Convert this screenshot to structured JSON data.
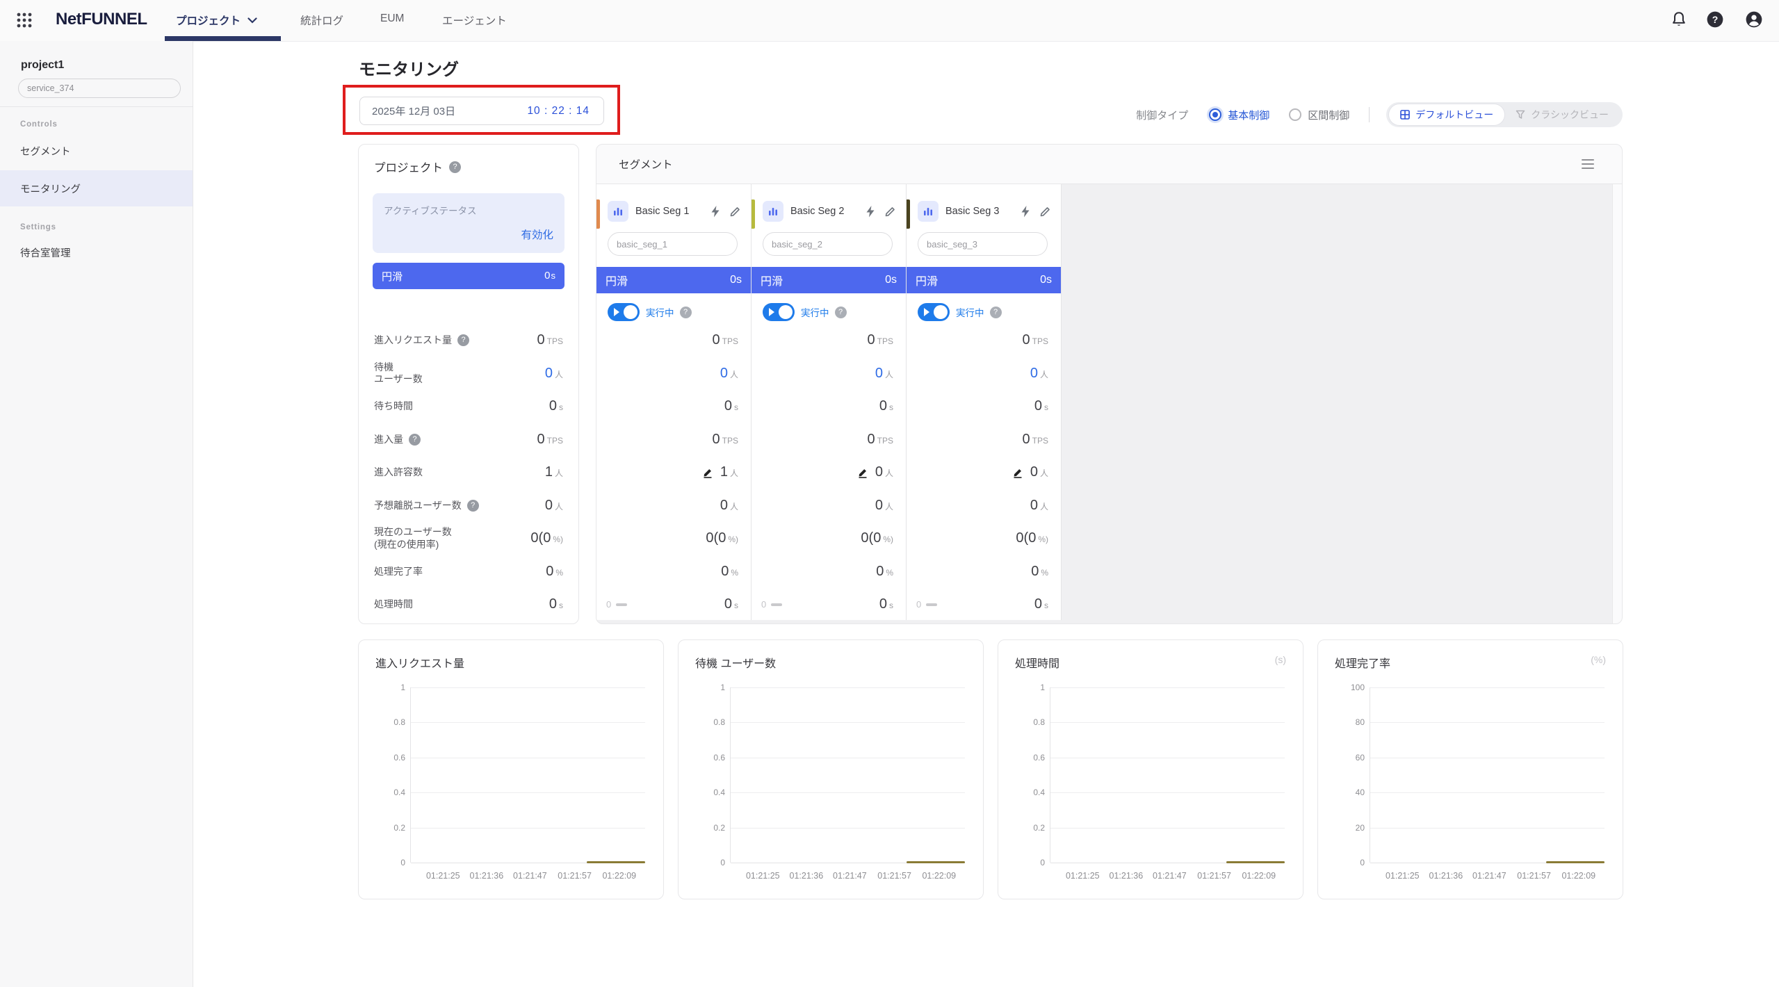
{
  "nav": {
    "logo": "NetFUNNEL",
    "tabs": [
      {
        "label": "プロジェクト",
        "active": true,
        "has_dropdown": true
      },
      {
        "label": "統計ログ",
        "active": false
      },
      {
        "label": "EUM",
        "active": false
      },
      {
        "label": "エージェント",
        "active": false
      }
    ],
    "right_icons": [
      "bell-icon",
      "help-icon",
      "account-icon"
    ],
    "left_icon": "apps-grid-icon"
  },
  "sidebar": {
    "project_name": "project1",
    "service_input": "service_374",
    "sections": [
      {
        "title": "Controls",
        "items": [
          {
            "label": "セグメント",
            "active": false
          },
          {
            "label": "モニタリング",
            "active": true
          }
        ]
      },
      {
        "title": "Settings",
        "items": [
          {
            "label": "待合室管理",
            "active": false
          }
        ]
      }
    ]
  },
  "page": {
    "title": "モニタリング",
    "date": "2025年 12月 03日",
    "time": "10 : 22 : 14",
    "control_type": {
      "label": "制御タイプ",
      "options": [
        {
          "label": "基本制御",
          "selected": true
        },
        {
          "label": "区間制御",
          "selected": false
        }
      ]
    },
    "view_toggle": [
      {
        "label": "デフォルトビュー",
        "active": true,
        "icon": "grid-view-icon"
      },
      {
        "label": "クラシックビュー",
        "active": false,
        "icon": "funnel-icon"
      }
    ]
  },
  "colors": {
    "accent_blue": "#2e6be5",
    "banner_blue": "#4d68ee",
    "toggle_blue": "#1e7bea",
    "nav_navy": "#2c3766",
    "annotation_red": "#df1d1d",
    "chart_line_olive": "#8a7b35"
  },
  "project_card": {
    "title": "プロジェクト",
    "status_label": "アクティブステータス",
    "status_value": "有効化",
    "banner": {
      "label": "円滑",
      "value": "0",
      "unit": "s"
    },
    "metrics": [
      {
        "label": "進入リクエスト量",
        "help": true,
        "value": "0",
        "unit": "TPS"
      },
      {
        "label": "待機\nユーザー数",
        "value": "0",
        "unit": "人",
        "blue": true
      },
      {
        "label": "待ち時間",
        "value": "0",
        "unit": "s"
      },
      {
        "label": "進入量",
        "help": true,
        "value": "0",
        "unit": "TPS"
      },
      {
        "label": "進入許容数",
        "value": "1",
        "unit": "人"
      },
      {
        "label": "予想離脱ユーザー数",
        "help": true,
        "value": "0",
        "unit": "人"
      },
      {
        "label": "現在のユーザー数\n(現在の使用率)",
        "value": "0(0",
        "unit": "%)"
      },
      {
        "label": "処理完了率",
        "value": "0",
        "unit": "%"
      },
      {
        "label": "処理時間",
        "value": "0",
        "unit": "s"
      }
    ]
  },
  "segment_panel": {
    "title": "セグメント",
    "menu_icon": "hamburger-icon",
    "cards": [
      {
        "name": "Basic Seg 1",
        "input": "basic_seg_1",
        "stripe_color": "#e08a4e",
        "status": {
          "label": "円滑",
          "value": "0",
          "unit": "s"
        },
        "toggle_label": "実行中",
        "toggle_on": true,
        "metrics": [
          {
            "value": "0",
            "unit": "TPS"
          },
          {
            "value": "0",
            "unit": "人",
            "blue": true
          },
          {
            "value": "0",
            "unit": "s"
          },
          {
            "value": "0",
            "unit": "TPS"
          },
          {
            "value": "1",
            "unit": "人",
            "edit": true
          },
          {
            "value": "0",
            "unit": "人"
          },
          {
            "value": "0(0",
            "unit": "%)"
          },
          {
            "value": "0",
            "unit": "%"
          },
          {
            "value": "0",
            "unit": "s",
            "footer_left": "0"
          }
        ]
      },
      {
        "name": "Basic Seg 2",
        "input": "basic_seg_2",
        "stripe_color": "#b7ba3e",
        "status": {
          "label": "円滑",
          "value": "0",
          "unit": "s"
        },
        "toggle_label": "実行中",
        "toggle_on": true,
        "metrics": [
          {
            "value": "0",
            "unit": "TPS"
          },
          {
            "value": "0",
            "unit": "人",
            "blue": true
          },
          {
            "value": "0",
            "unit": "s"
          },
          {
            "value": "0",
            "unit": "TPS"
          },
          {
            "value": "0",
            "unit": "人",
            "edit": true
          },
          {
            "value": "0",
            "unit": "人"
          },
          {
            "value": "0(0",
            "unit": "%)"
          },
          {
            "value": "0",
            "unit": "%"
          },
          {
            "value": "0",
            "unit": "s",
            "footer_left": "0"
          }
        ]
      },
      {
        "name": "Basic Seg 3",
        "input": "basic_seg_3",
        "stripe_color": "#4a431f",
        "status": {
          "label": "円滑",
          "value": "0",
          "unit": "s"
        },
        "toggle_label": "実行中",
        "toggle_on": true,
        "metrics": [
          {
            "value": "0",
            "unit": "TPS"
          },
          {
            "value": "0",
            "unit": "人",
            "blue": true
          },
          {
            "value": "0",
            "unit": "s"
          },
          {
            "value": "0",
            "unit": "TPS"
          },
          {
            "value": "0",
            "unit": "人",
            "edit": true
          },
          {
            "value": "0",
            "unit": "人"
          },
          {
            "value": "0(0",
            "unit": "%)"
          },
          {
            "value": "0",
            "unit": "%"
          },
          {
            "value": "0",
            "unit": "s",
            "footer_left": "0"
          }
        ]
      }
    ]
  },
  "chart_data": [
    {
      "type": "line",
      "title": "進入リクエスト量",
      "unit": "",
      "ylim": [
        0,
        1
      ],
      "y_ticks": [
        "1",
        "0.8",
        "0.6",
        "0.4",
        "0.2",
        "0"
      ],
      "x_ticks": [
        "01:21:25",
        "01:21:36",
        "01:21:47",
        "01:21:57",
        "01:22:09"
      ],
      "grid": true,
      "legend": "none",
      "series": [
        {
          "name": "進入リクエスト量",
          "value": 0,
          "x_span_frac": [
            0.75,
            1.0
          ],
          "color": "#8a7b35"
        }
      ]
    },
    {
      "type": "line",
      "title": "待機 ユーザー数",
      "unit": "",
      "ylim": [
        0,
        1
      ],
      "y_ticks": [
        "1",
        "0.8",
        "0.6",
        "0.4",
        "0.2",
        "0"
      ],
      "x_ticks": [
        "01:21:25",
        "01:21:36",
        "01:21:47",
        "01:21:57",
        "01:22:09"
      ],
      "grid": true,
      "legend": "none",
      "series": [
        {
          "name": "待機 ユーザー数",
          "value": 0,
          "x_span_frac": [
            0.75,
            1.0
          ],
          "color": "#8a7b35"
        }
      ]
    },
    {
      "type": "line",
      "title": "処理時間",
      "unit": "(s)",
      "ylim": [
        0,
        1
      ],
      "y_ticks": [
        "1",
        "0.8",
        "0.6",
        "0.4",
        "0.2",
        "0"
      ],
      "x_ticks": [
        "01:21:25",
        "01:21:36",
        "01:21:47",
        "01:21:57",
        "01:22:09"
      ],
      "grid": true,
      "legend": "none",
      "series": [
        {
          "name": "処理時間",
          "value": 0,
          "x_span_frac": [
            0.75,
            1.0
          ],
          "color": "#8a7b35"
        }
      ]
    },
    {
      "type": "line",
      "title": "処理完了率",
      "unit": "(%)",
      "ylim": [
        0,
        100
      ],
      "y_ticks": [
        "100",
        "80",
        "60",
        "40",
        "20",
        "0"
      ],
      "x_ticks": [
        "01:21:25",
        "01:21:36",
        "01:21:47",
        "01:21:57",
        "01:22:09"
      ],
      "grid": true,
      "legend": "none",
      "series": [
        {
          "name": "処理完了率",
          "value": 0,
          "x_span_frac": [
            0.75,
            1.0
          ],
          "color": "#8a7b35"
        }
      ]
    }
  ]
}
